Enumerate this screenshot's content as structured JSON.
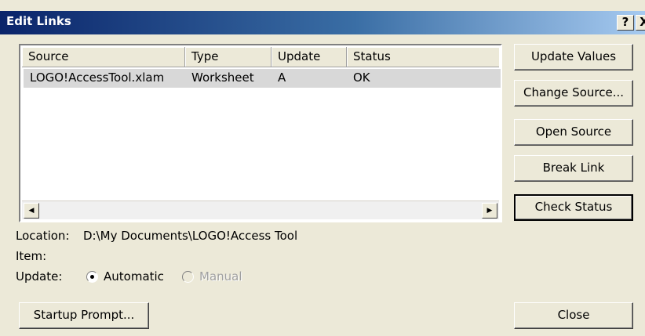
{
  "dialog": {
    "title": "Edit Links",
    "help_label": "?",
    "close_label": "X"
  },
  "list": {
    "columns": [
      "Source",
      "Type",
      "Update",
      "Status"
    ],
    "rows": [
      [
        "LOGO!AccessTool.xlam",
        "Worksheet",
        "A",
        "OK"
      ]
    ]
  },
  "buttons": {
    "update_values": "Update Values",
    "change_source": "Change Source...",
    "open_source": "Open Source",
    "break_link": "Break Link",
    "check_status": "Check Status",
    "startup_prompt": "Startup Prompt...",
    "close": "Close"
  },
  "details": {
    "location_label": "Location:",
    "location_value": "D:\\My Documents\\LOGO!Access Tool",
    "item_label": "Item:",
    "update_label": "Update:",
    "automatic": "Automatic",
    "manual": "Manual",
    "selected_update_mode": "Automatic"
  }
}
